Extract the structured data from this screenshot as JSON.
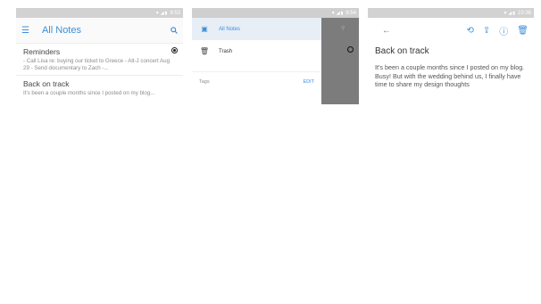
{
  "screens": {
    "list": {
      "status_time": "9:53",
      "title": "All Notes",
      "notes": [
        {
          "title": "Reminders",
          "body": "- Call Lisa re: buying our ticket to Greece - Alt-J concert Aug 29 - Send documentary to Zach -..."
        },
        {
          "title": "Back on track",
          "body": "It's been a couple months since I posted on my blog..."
        }
      ]
    },
    "drawer": {
      "status_time": "9:54",
      "items": [
        {
          "label": "All Notes",
          "icon": "notes-icon"
        },
        {
          "label": "Trash",
          "icon": "trash-icon"
        }
      ],
      "tags_label": "Tags",
      "edit_label": "EDIT"
    },
    "editor": {
      "status_time": "10:36",
      "title": "Back on track",
      "body": "It's been a couple months since I posted on my blog. Busy! But with the wedding behind us, I finally have time to share my design thoughts"
    }
  }
}
